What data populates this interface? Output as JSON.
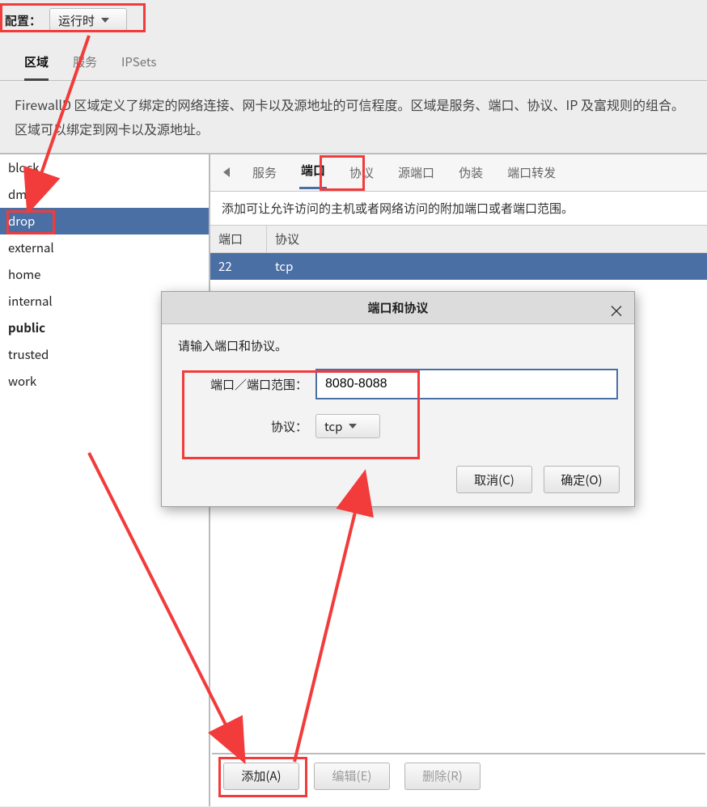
{
  "top": {
    "config_label": "配置：",
    "config_value": "运行时"
  },
  "mainTabs": {
    "zones": "区域",
    "services": "服务",
    "ipsets": "IPSets"
  },
  "description": "FirewallD 区域定义了绑定的网络连接、网卡以及源地址的可信程度。区域是服务、端口、协议、IP 及富规则的组合。区域可以绑定到网卡以及源地址。",
  "zones": [
    "block",
    "dmz",
    "drop",
    "external",
    "home",
    "internal",
    "public",
    "trusted",
    "work"
  ],
  "selected_zone_index": 2,
  "public_bold_index": 6,
  "innerTabs": {
    "services": "服务",
    "ports": "端口",
    "protocols": "协议",
    "source_ports": "源端口",
    "masquerade": "伪装",
    "port_forward": "端口转发"
  },
  "ports": {
    "subdesc": "添加可让允许访问的主机或者网络访问的附加端口或者端口范围。",
    "col_port": "端口",
    "col_proto": "协议",
    "rows": [
      {
        "port": "22",
        "proto": "tcp"
      }
    ]
  },
  "actions": {
    "add": "添加(A)",
    "edit": "编辑(E)",
    "remove": "删除(R)"
  },
  "dialog": {
    "title": "端口和协议",
    "desc": "请输入端口和协议。",
    "port_label": "端口／端口范围：",
    "port_value": "8080-8088",
    "proto_label": "协议：",
    "proto_value": "tcp",
    "cancel": "取消(C)",
    "ok": "确定(O)"
  }
}
